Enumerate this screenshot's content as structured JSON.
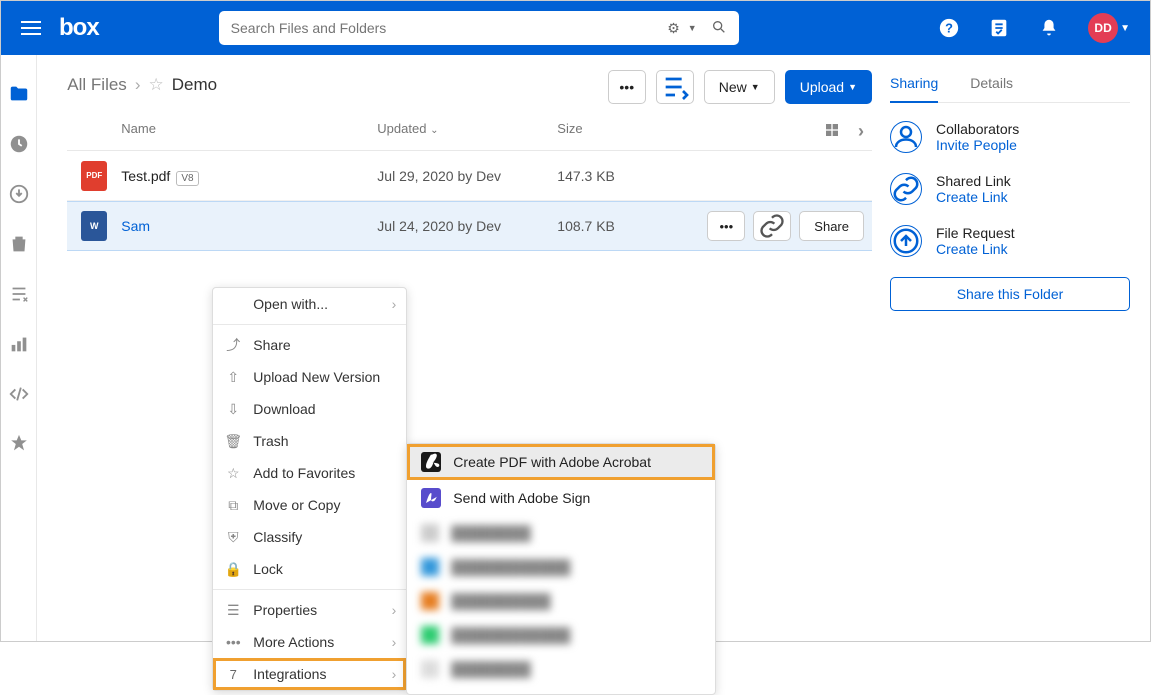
{
  "header": {
    "logo": "box",
    "search_placeholder": "Search Files and Folders",
    "avatar_initials": "DD"
  },
  "breadcrumb": {
    "root": "All Files",
    "current": "Demo"
  },
  "toolbar": {
    "new_label": "New",
    "upload_label": "Upload"
  },
  "columns": {
    "name": "Name",
    "updated": "Updated",
    "size": "Size"
  },
  "files": [
    {
      "name": "Test.pdf",
      "badge": "V8",
      "updated": "Jul 29, 2020 by Dev",
      "size": "147.3 KB",
      "type": "pdf"
    },
    {
      "name": "Sam",
      "updated": "Jul 24, 2020 by Dev",
      "size": "108.7 KB",
      "type": "doc"
    }
  ],
  "row_actions": {
    "share": "Share"
  },
  "context_menu": {
    "open_with": "Open with...",
    "share": "Share",
    "upload_new": "Upload New Version",
    "download": "Download",
    "trash": "Trash",
    "favorites": "Add to Favorites",
    "move_copy": "Move or Copy",
    "classify": "Classify",
    "lock": "Lock",
    "properties": "Properties",
    "more_actions": "More Actions",
    "integrations": "Integrations",
    "integrations_count": "7"
  },
  "submenu": {
    "create_pdf": "Create PDF with Adobe Acrobat",
    "send_sign": "Send with Adobe Sign"
  },
  "sidebar": {
    "tabs": {
      "sharing": "Sharing",
      "details": "Details"
    },
    "collaborators": {
      "title": "Collaborators",
      "link": "Invite People"
    },
    "shared_link": {
      "title": "Shared Link",
      "link": "Create Link"
    },
    "file_request": {
      "title": "File Request",
      "link": "Create Link"
    },
    "share_folder": "Share this Folder"
  }
}
